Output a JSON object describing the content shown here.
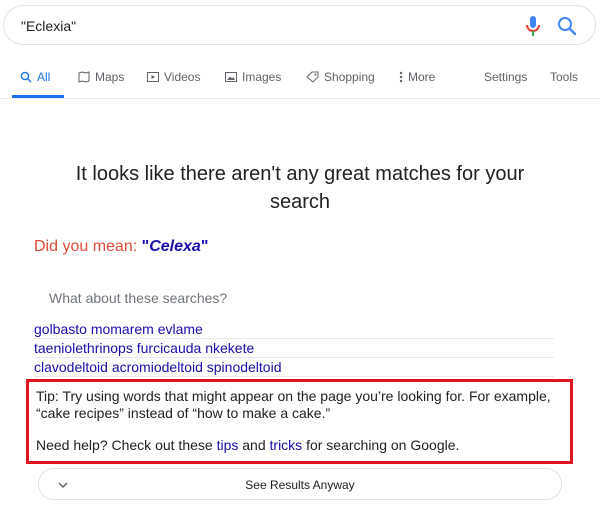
{
  "search": {
    "query": "\"Eclexia\""
  },
  "tabs": {
    "all": "All",
    "maps": "Maps",
    "videos": "Videos",
    "images": "Images",
    "shopping": "Shopping",
    "more": "More",
    "settings": "Settings",
    "tools": "Tools"
  },
  "main": {
    "nomatch_line1": "It looks like there aren't any great matches for your",
    "nomatch_line2": "search",
    "did_you_mean_label": "Did you mean:",
    "did_you_mean_suggestion": "Celexa",
    "what_about": "What about these searches?",
    "related": [
      "golbasto momarem evlame",
      "taeniolethrinops furcicauda nkekete",
      "clavodeltoid acromiodeltoid spinodeltoid"
    ],
    "tip": "Tip: Try using words that might appear on the page you’re looking for. For example, “cake recipes” instead of “how to make a cake.”",
    "help_prefix": "Need help? Check out these",
    "help_link1": "tips",
    "help_and": "and",
    "help_link2": "tricks",
    "help_suffix": "for searching on Google.",
    "see_results": "See Results Anyway"
  },
  "colors": {
    "accent": "#1a73e8",
    "link": "#1a0dab",
    "error": "#dd4b39",
    "highlight_box": "#e0151f"
  }
}
